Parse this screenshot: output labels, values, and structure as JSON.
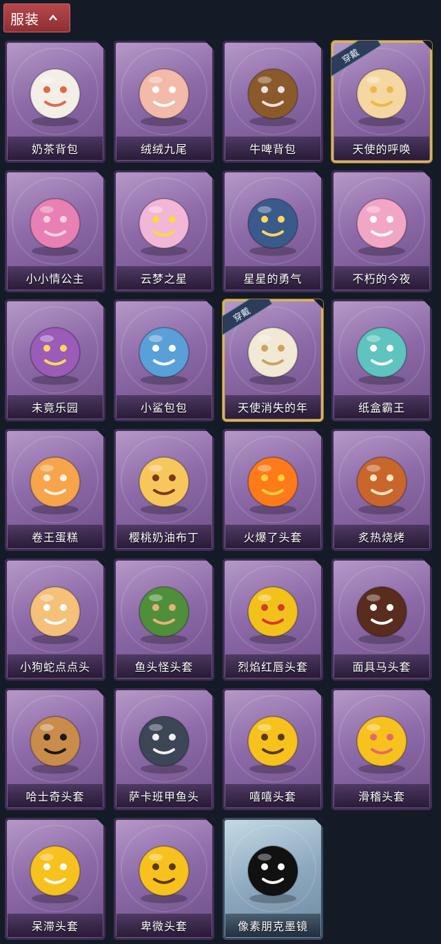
{
  "section": {
    "title": "服装"
  },
  "worn_label": "穿戴",
  "items": [
    {
      "label": "奶茶背包",
      "worn": false,
      "theme": "purple",
      "icon": "milk-tea-backpack-icon",
      "color": "#f3efe6",
      "accent": "#d96b4a"
    },
    {
      "label": "绒绒九尾",
      "worn": false,
      "theme": "purple",
      "icon": "nine-tail-fox-icon",
      "color": "#f3b9a9",
      "accent": "#ffffff"
    },
    {
      "label": "牛啤背包",
      "worn": false,
      "theme": "purple",
      "icon": "beer-barrel-cow-icon",
      "color": "#8b5a2b",
      "accent": "#f2dfe6"
    },
    {
      "label": "天使的呼唤",
      "worn": true,
      "theme": "purple",
      "icon": "angel-charm-icon",
      "color": "#f4d7a1",
      "accent": "#e9b94a"
    },
    {
      "label": "小小情公主",
      "worn": false,
      "theme": "purple",
      "icon": "pink-princess-icon",
      "color": "#e880b3",
      "accent": "#f6d2e4"
    },
    {
      "label": "云梦之星",
      "worn": false,
      "theme": "purple",
      "icon": "unicorn-star-icon",
      "color": "#f2b6d8",
      "accent": "#ffd93b"
    },
    {
      "label": "星星的勇气",
      "worn": false,
      "theme": "purple",
      "icon": "star-prince-icon",
      "color": "#3a5a8c",
      "accent": "#ffd65a"
    },
    {
      "label": "不朽的今夜",
      "worn": false,
      "theme": "purple",
      "icon": "pink-cat-bowl-icon",
      "color": "#f2a6c6",
      "accent": "#ffffff"
    },
    {
      "label": "未竟乐园",
      "worn": false,
      "theme": "purple",
      "icon": "purple-girl-icon",
      "color": "#9b5bb8",
      "accent": "#ffd65a"
    },
    {
      "label": "小鲨包包",
      "worn": false,
      "theme": "purple",
      "icon": "shark-charm-icon",
      "color": "#5aa0d8",
      "accent": "#ffffff"
    },
    {
      "label": "天使消失的年",
      "worn": true,
      "theme": "purple",
      "icon": "hooded-angel-icon",
      "color": "#f1e9d6",
      "accent": "#caa460"
    },
    {
      "label": "纸盒霸王",
      "worn": false,
      "theme": "purple",
      "icon": "box-dino-icon",
      "color": "#5fc3c0",
      "accent": "#ffffff"
    },
    {
      "label": "卷王蛋糕",
      "worn": false,
      "theme": "purple",
      "icon": "roll-cake-icon",
      "color": "#f6a54b",
      "accent": "#fff3e2"
    },
    {
      "label": "樱桃奶油布丁",
      "worn": false,
      "theme": "purple",
      "icon": "cherry-pudding-icon",
      "color": "#f7c75b",
      "accent": "#7a3a1b"
    },
    {
      "label": "火爆了头套",
      "worn": false,
      "theme": "purple",
      "icon": "fire-head-icon",
      "color": "#ff7a1a",
      "accent": "#ffd13b"
    },
    {
      "label": "炙热烧烤",
      "worn": false,
      "theme": "purple",
      "icon": "meat-head-icon",
      "color": "#c9662c",
      "accent": "#ffe6c9"
    },
    {
      "label": "小狗蛇点点头",
      "worn": false,
      "theme": "purple",
      "icon": "snake-dog-icon",
      "color": "#f5c07a",
      "accent": "#ffffff"
    },
    {
      "label": "鱼头怪头套",
      "worn": false,
      "theme": "purple",
      "icon": "fish-mask-icon",
      "color": "#4f8f3a",
      "accent": "#e7b27a"
    },
    {
      "label": "烈焰红唇头套",
      "worn": false,
      "theme": "purple",
      "icon": "pikachu-mask-icon",
      "color": "#f2c21a",
      "accent": "#d63a2a"
    },
    {
      "label": "面具马头套",
      "worn": false,
      "theme": "purple",
      "icon": "horse-mask-icon",
      "color": "#5a2c1e",
      "accent": "#ffffff"
    },
    {
      "label": "哈士奇头套",
      "worn": false,
      "theme": "purple",
      "icon": "husky-mask-icon",
      "color": "#c98c4a",
      "accent": "#1a1a1a"
    },
    {
      "label": "萨卡班甲鱼头",
      "worn": false,
      "theme": "purple",
      "icon": "sacabambaspis-icon",
      "color": "#3c4656",
      "accent": "#f0f0f0"
    },
    {
      "label": "嘻嘻头套",
      "worn": false,
      "theme": "purple",
      "icon": "grin-emoji-icon",
      "color": "#f7c21e",
      "accent": "#5a3a0a"
    },
    {
      "label": "滑稽头套",
      "worn": false,
      "theme": "purple",
      "icon": "funny-emoji-icon",
      "color": "#f7c21e",
      "accent": "#e06a6a"
    },
    {
      "label": "呆滞头套",
      "worn": false,
      "theme": "purple",
      "icon": "dazed-emoji-icon",
      "color": "#f7c21e",
      "accent": "#ffffff"
    },
    {
      "label": "卑微头套",
      "worn": false,
      "theme": "purple",
      "icon": "humble-emoji-icon",
      "color": "#f7c21e",
      "accent": "#5a3a0a"
    },
    {
      "label": "像素朋克墨镜",
      "worn": false,
      "theme": "blue",
      "icon": "pixel-sunglasses-icon",
      "color": "#111111",
      "accent": "#ffffff"
    }
  ]
}
